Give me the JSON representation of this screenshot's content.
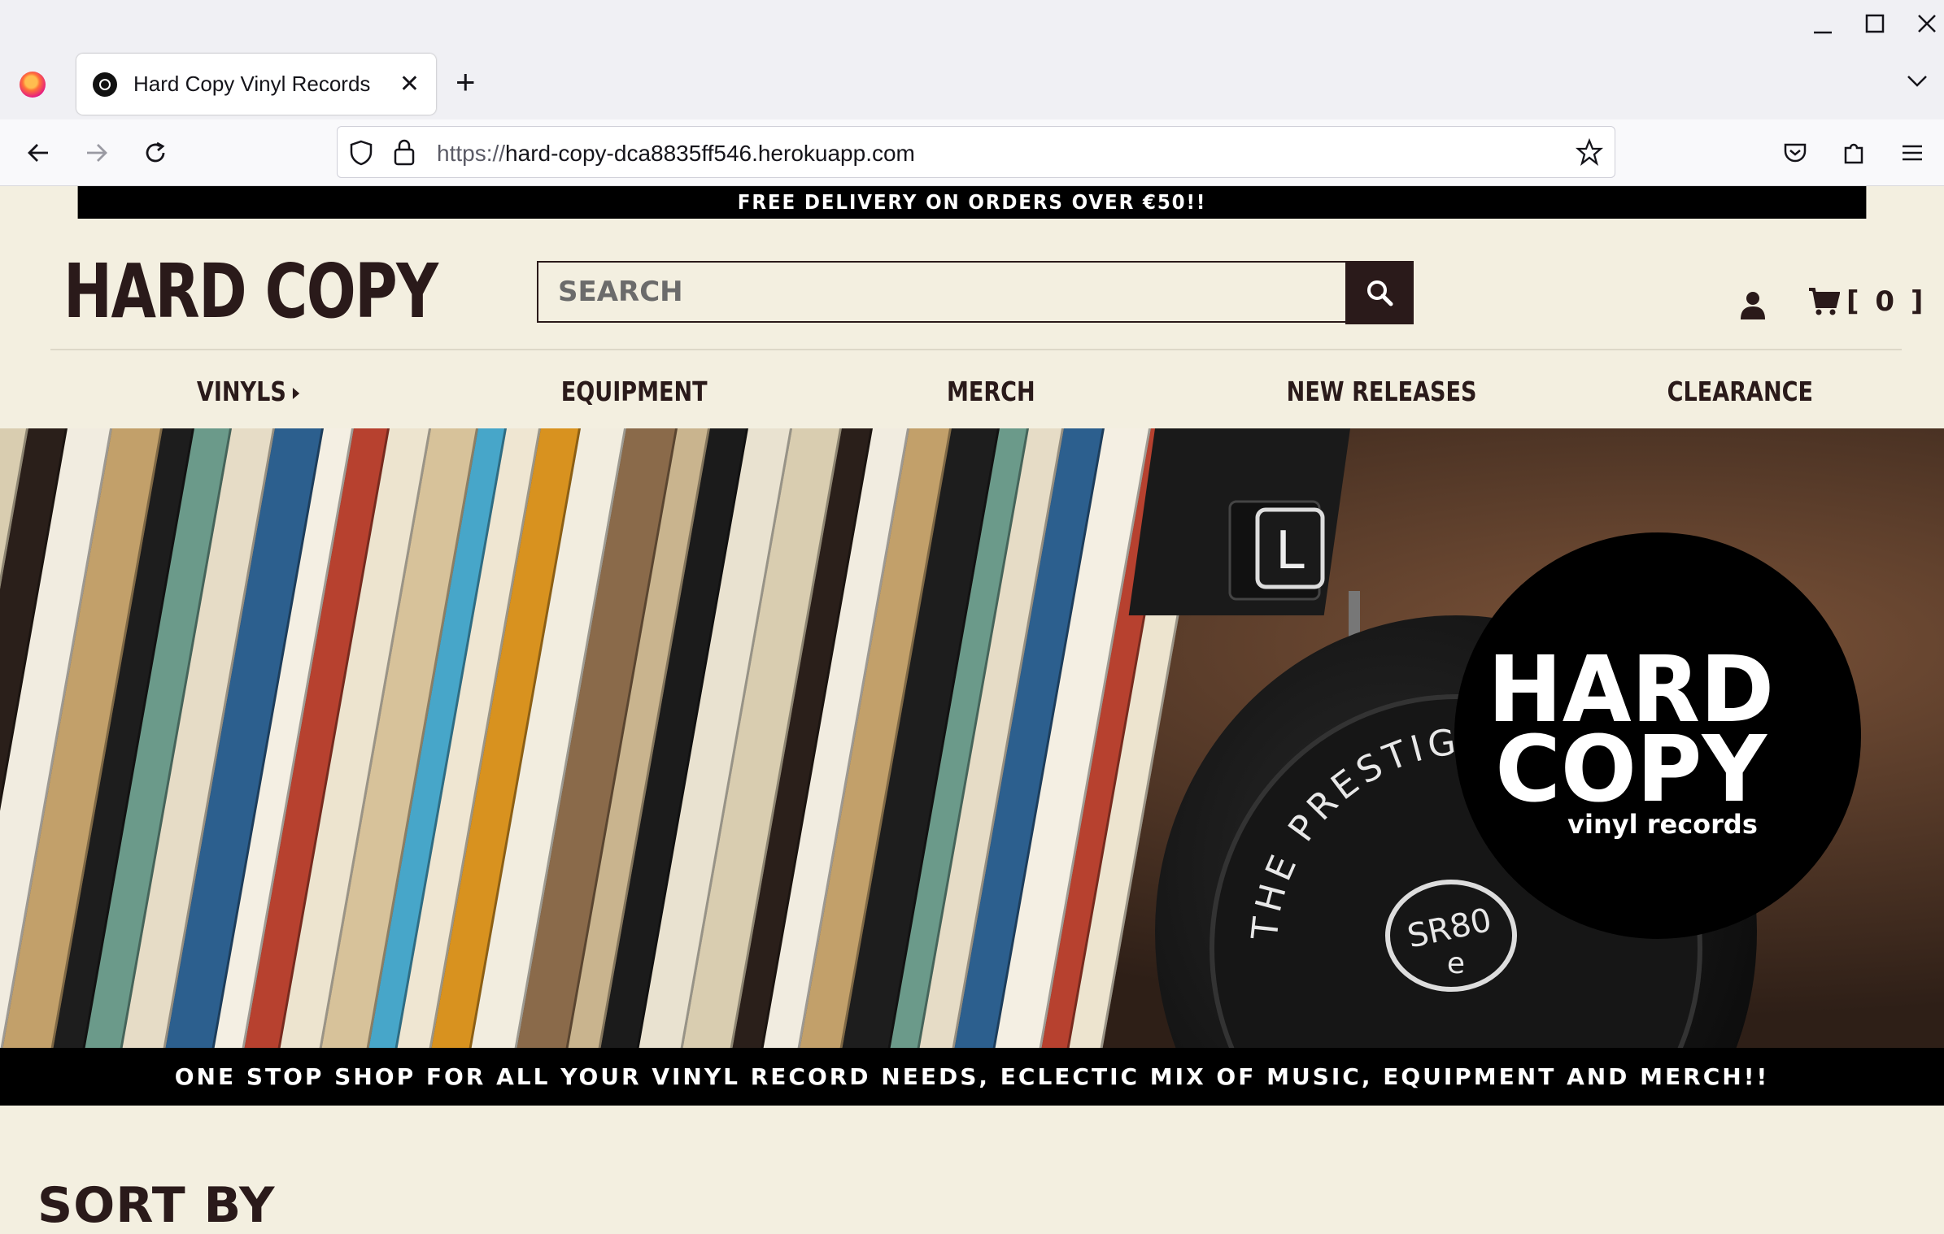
{
  "browser": {
    "tab_title": "Hard Copy Vinyl Records",
    "url_scheme": "https://",
    "url_host": "hard-copy-dca8835ff546.herokuapp.com"
  },
  "promo": {
    "text": "FREE DELIVERY ON ORDERS OVER €50!!"
  },
  "header": {
    "logo": "HARD COPY",
    "search_placeholder": "SEARCH",
    "cart_count": "[ 0 ]"
  },
  "nav": {
    "items": [
      {
        "label": "VINYLS"
      },
      {
        "label": "EQUIPMENT"
      },
      {
        "label": "MERCH"
      },
      {
        "label": "NEW RELEASES"
      },
      {
        "label": "CLEARANCE"
      }
    ]
  },
  "hero": {
    "badge_line1": "HARD",
    "badge_line2": "COPY",
    "badge_sub": "vinyl records",
    "headphone_text": "THE PRESTIGE",
    "headphone_model": "SR80",
    "headphone_model_sub": "e",
    "cup_letter": "L"
  },
  "tagline": {
    "text": "ONE STOP SHOP FOR ALL YOUR VINYL RECORD NEEDS, ECLECTIC MIX OF MUSIC, EQUIPMENT AND MERCH!!"
  },
  "sort": {
    "heading": "SORT BY"
  },
  "icons": {
    "firefox": "firefox-logo-icon",
    "favicon": "vinyl-record-icon",
    "search": "magnifier-icon",
    "account": "person-icon",
    "cart": "shopping-cart-icon"
  }
}
